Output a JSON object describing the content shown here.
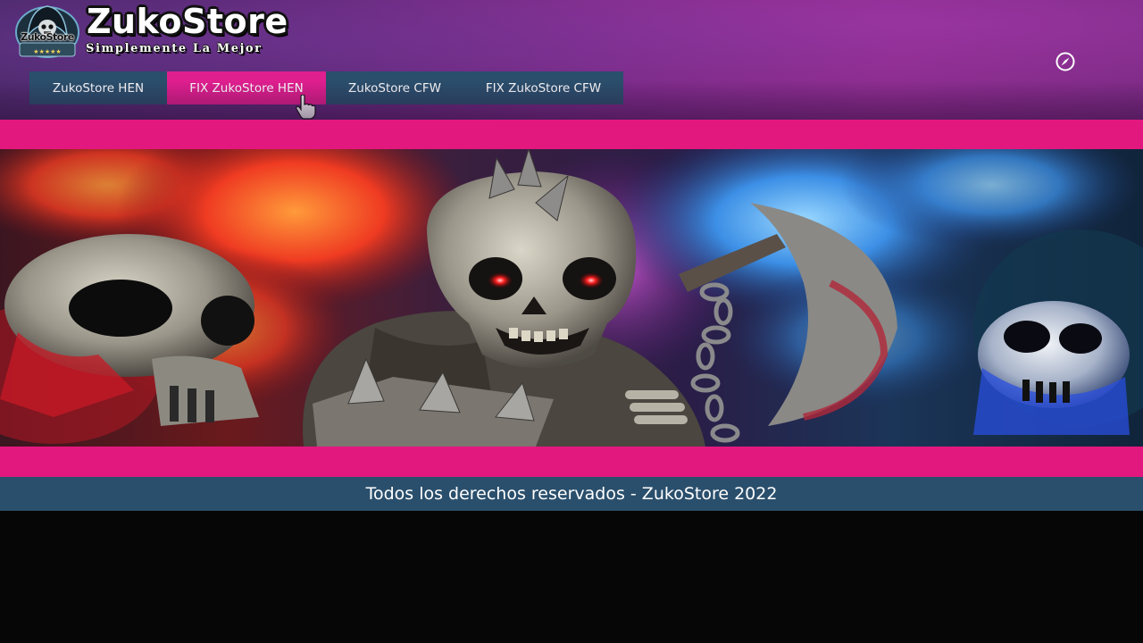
{
  "header": {
    "logo_badge_text": "ZukoStore",
    "title": "ZukoStore",
    "tagline": "Simplemente La Mejor"
  },
  "nav": {
    "tabs": [
      {
        "label": "ZukoStore HEN",
        "active": false
      },
      {
        "label": "FIX ZukoStore HEN",
        "active": true
      },
      {
        "label": "ZukoStore CFW",
        "active": false
      },
      {
        "label": "FIX ZukoStore CFW",
        "active": false
      }
    ]
  },
  "icons": {
    "cursor": "hand-pointer-icon",
    "compass": "compass-icon",
    "badge": "skull-hood-logo"
  },
  "banner": {
    "description_icon": "skull-warrior-banner"
  },
  "footer": {
    "text": "Todos los derechos reservados - ZukoStore 2022"
  },
  "colors": {
    "accent_pink": "#e3187f",
    "nav_blue": "#2a4f6c",
    "header_purple": "#6a2a7c",
    "background": "#060606"
  }
}
